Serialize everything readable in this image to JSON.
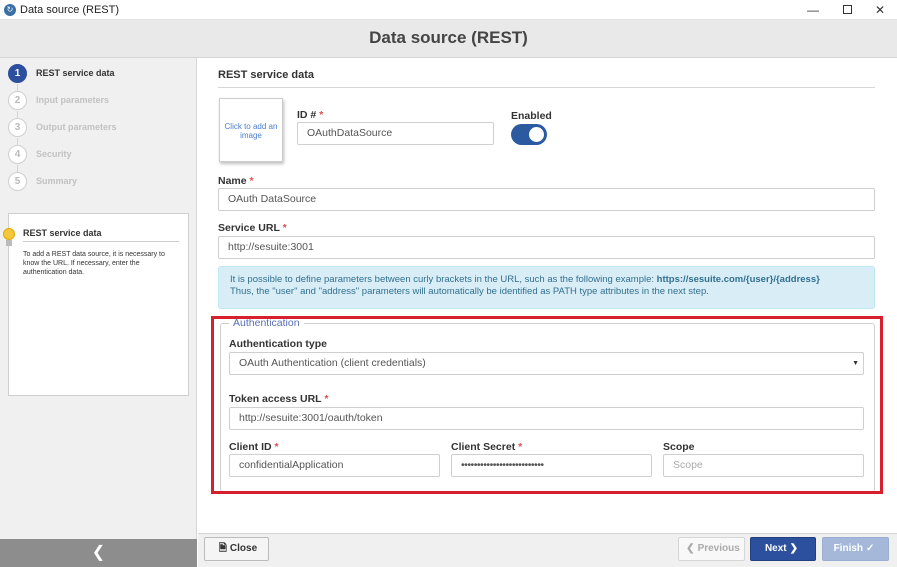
{
  "window": {
    "title": "Data source (REST)",
    "controls": {
      "minimize": "—",
      "close": "✕"
    }
  },
  "header": {
    "title": "Data source (REST)"
  },
  "steps": [
    {
      "num": "1",
      "label": "REST service data",
      "active": true
    },
    {
      "num": "2",
      "label": "Input parameters",
      "active": false
    },
    {
      "num": "3",
      "label": "Output parameters",
      "active": false
    },
    {
      "num": "4",
      "label": "Security",
      "active": false
    },
    {
      "num": "5",
      "label": "Summary",
      "active": false
    }
  ],
  "help": {
    "title": "REST service data",
    "text": "To add a REST data source, it is necessary to know the URL. If necessary, enter the authentication data."
  },
  "main": {
    "section_title": "REST service data",
    "image_placeholder": "Click to add an image",
    "id_label": "ID #",
    "id_value": "OAuthDataSource",
    "enabled_label": "Enabled",
    "enabled": true,
    "name_label": "Name",
    "name_value": "OAuth DataSource",
    "url_label": "Service URL",
    "url_value": "http://sesuite:3001",
    "info_line1": "It is possible to define parameters between curly brackets in the URL, such as the following example: ",
    "info_example": "https://sesuite.com/{user}/{address}",
    "info_line2": "Thus, the \"user\" and \"address\" parameters will automatically be identified as PATH type attributes in the next step."
  },
  "auth": {
    "legend": "Authentication",
    "type_label": "Authentication type",
    "type_value": "OAuth Authentication (client credentials)",
    "token_label": "Token access URL",
    "token_value": "http://sesuite:3001/oauth/token",
    "client_id_label": "Client ID",
    "client_id_value": "confidentialApplication",
    "secret_label": "Client Secret",
    "secret_value": "••••••••••••••••••••••••••",
    "scope_label": "Scope",
    "scope_placeholder": "Scope"
  },
  "footer": {
    "close": "Close",
    "previous": "Previous",
    "next": "Next",
    "finish": "Finish"
  },
  "colors": {
    "primary": "#2c4f9e",
    "highlight": "#d7202e",
    "info_bg": "#d9edf7",
    "required": "#d9534f"
  }
}
